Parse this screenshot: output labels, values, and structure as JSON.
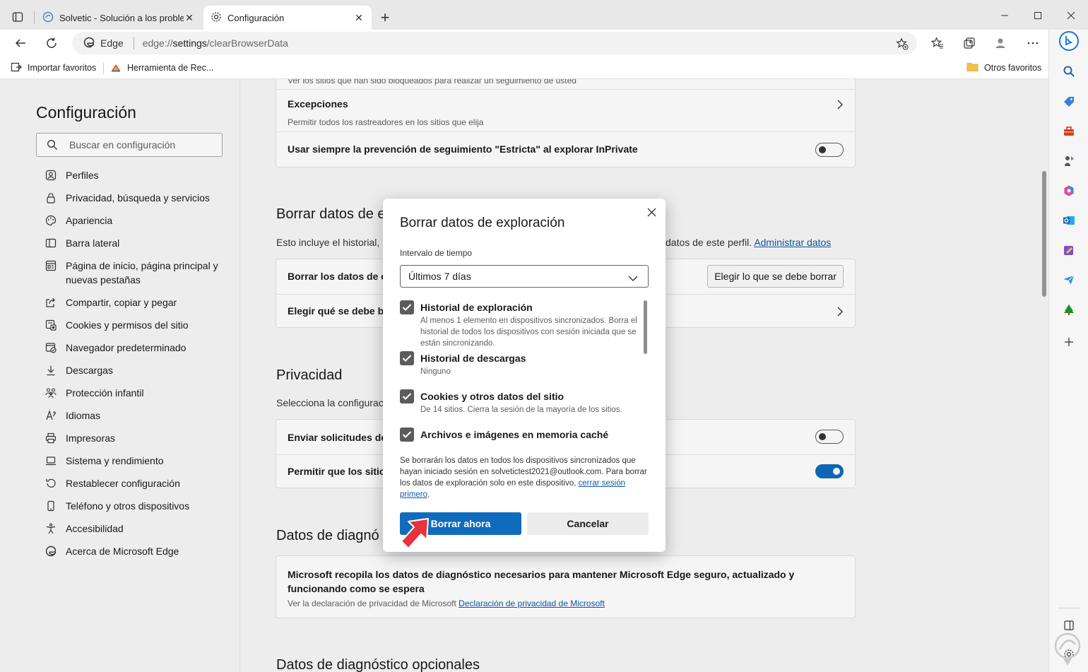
{
  "tabs": [
    {
      "title": "Solvetic - Solución a los problem",
      "active": false,
      "icon": "solvetic-icon"
    },
    {
      "title": "Configuración",
      "active": true,
      "icon": "gear-icon"
    }
  ],
  "address": {
    "chip": "Edge",
    "url_scheme": "edge://",
    "url_host": "settings",
    "url_path": "/clearBrowserData"
  },
  "favorites": {
    "items": [
      {
        "label": "Importar favoritos",
        "icon": "import-icon"
      },
      {
        "label": "Herramienta de Rec...",
        "icon": "tool-icon"
      }
    ],
    "other": "Otros favoritos"
  },
  "nav": {
    "title": "Configuración",
    "search_placeholder": "Buscar en configuración",
    "items": [
      {
        "label": "Perfiles",
        "icon": "profile-icon"
      },
      {
        "label": "Privacidad, búsqueda y servicios",
        "icon": "lock-icon"
      },
      {
        "label": "Apariencia",
        "icon": "palette-icon"
      },
      {
        "label": "Barra lateral",
        "icon": "sidebar-icon"
      },
      {
        "label": "Página de inicio, página principal y nuevas pestañas",
        "icon": "home-icon"
      },
      {
        "label": "Compartir, copiar y pegar",
        "icon": "share-icon"
      },
      {
        "label": "Cookies y permisos del sitio",
        "icon": "cookie-icon"
      },
      {
        "label": "Navegador predeterminado",
        "icon": "browser-icon"
      },
      {
        "label": "Descargas",
        "icon": "download-icon"
      },
      {
        "label": "Protección infantil",
        "icon": "family-icon"
      },
      {
        "label": "Idiomas",
        "icon": "language-icon"
      },
      {
        "label": "Impresoras",
        "icon": "printer-icon"
      },
      {
        "label": "Sistema y rendimiento",
        "icon": "laptop-icon"
      },
      {
        "label": "Restablecer configuración",
        "icon": "reset-icon"
      },
      {
        "label": "Teléfono y otros dispositivos",
        "icon": "phone-icon"
      },
      {
        "label": "Accesibilidad",
        "icon": "accessibility-icon"
      },
      {
        "label": "Acerca de Microsoft Edge",
        "icon": "edge-icon"
      }
    ]
  },
  "content": {
    "tracking_card": {
      "top_sub": "Ver los sitios que han sido bloqueados para realizar un seguimiento de usted",
      "exceptions_title": "Excepciones",
      "exceptions_sub": "Permitir todos los rastreadores en los sitios que elija",
      "strict_title": "Usar siempre la prevención de seguimiento \"Estricta\" al explorar InPrivate"
    },
    "clear_section": {
      "title": "Borrar datos de e",
      "desc_start": "Esto incluye el historial, l",
      "desc_end": "datos de este perfil.",
      "manage_link": "Administrar datos",
      "row1": "Borrar los datos de ex",
      "row1_button": "Elegir lo que se debe borrar",
      "row2": "Elegir qué se debe bo"
    },
    "privacy_section": {
      "title": "Privacidad",
      "desc": "Selecciona la configuraci",
      "row1": "Enviar solicitudes de \"",
      "row2": "Permitir que los sitios"
    },
    "diag_section": {
      "title": "Datos de diagnó",
      "card_title": "Microsoft recopila los datos de diagnóstico necesarios para mantener Microsoft Edge seguro, actualizado y funcionando como se espera",
      "card_sub": "Ver la declaración de privacidad de Microsoft",
      "card_link": "Declaración de privacidad de Microsoft"
    },
    "optional_title": "Datos de diagnóstico opcionales"
  },
  "dialog": {
    "title": "Borrar datos de exploración",
    "range_label": "Intervalo de tiempo",
    "range_value": "Últimos 7 días",
    "options": [
      {
        "title": "Historial de exploración",
        "sub": "Al menos 1 elemento en dispositivos sincronizados. Borra el historial de todos los dispositivos con sesión iniciada que se están sincronizando.",
        "checked": true
      },
      {
        "title": "Historial de descargas",
        "sub": "Ninguno",
        "checked": true
      },
      {
        "title": "Cookies y otros datos del sitio",
        "sub": "De 14 sitios. Cierra la sesión de la mayoría de los sitios.",
        "checked": true
      },
      {
        "title": "Archivos e imágenes en memoria caché",
        "sub": "",
        "checked": true
      }
    ],
    "note": "Se borrarán los datos en todos los dispositivos sincronizados que hayan iniciado sesión en solvetictest2021@outlook.com. Para borrar los datos de exploración solo en este dispositivo,",
    "note_link": "cerrar sesión primero",
    "note_end": ".",
    "primary_button": "Borrar ahora",
    "secondary_button": "Cancelar"
  },
  "colors": {
    "accent": "#0f6cbd",
    "pointer": "#e8323c"
  }
}
